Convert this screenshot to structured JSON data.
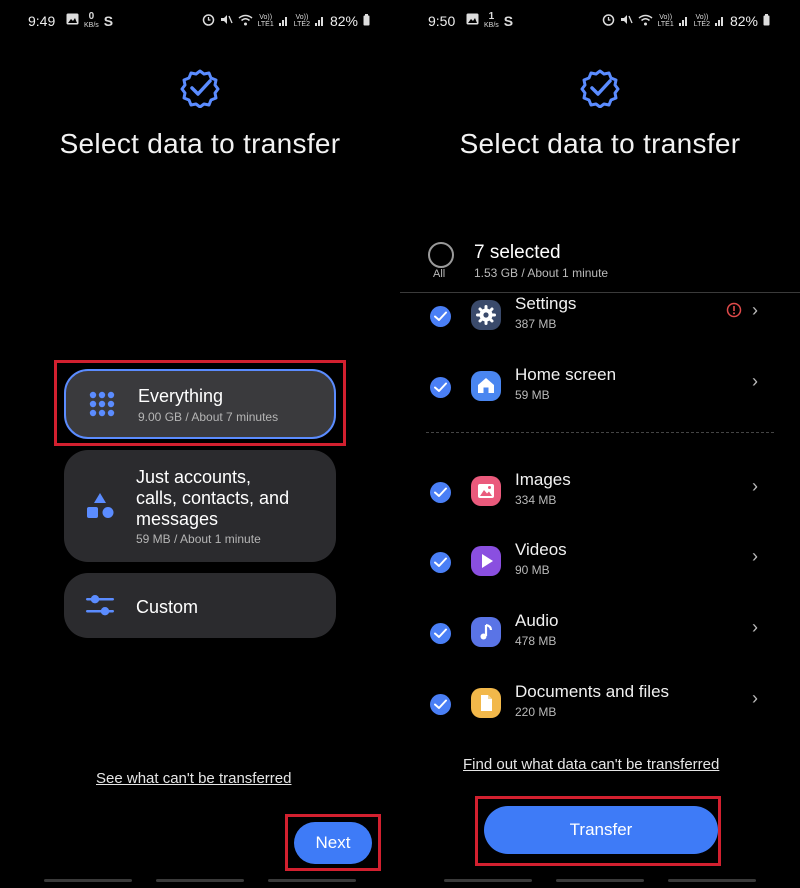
{
  "left": {
    "status": {
      "time": "9:49",
      "net_speed": "0",
      "net_unit": "KB/s",
      "carrier_s": "S",
      "lte1_top": "Vo))",
      "lte1_bot": "LTE1",
      "lte2_top": "Vo))",
      "lte2_bot": "LTE2",
      "battery": "82%"
    },
    "title": "Select data to transfer",
    "options": [
      {
        "title": "Everything",
        "subtitle": "9.00 GB / About 7 minutes"
      },
      {
        "title_lines": [
          "Just accounts,",
          "calls, contacts, and",
          "messages"
        ],
        "subtitle": "59 MB / About 1 minute"
      },
      {
        "title": "Custom"
      }
    ],
    "link": "See what can't be transferred",
    "next_label": "Next"
  },
  "right": {
    "status": {
      "time": "9:50",
      "net_speed": "1",
      "net_unit": "KB/s",
      "carrier_s": "S",
      "lte1_top": "Vo))",
      "lte1_bot": "LTE1",
      "lte2_top": "Vo))",
      "lte2_bot": "LTE2",
      "battery": "82%"
    },
    "title": "Select data to transfer",
    "all_label": "All",
    "selected_title": "7 selected",
    "selected_sub": "1.53 GB / About 1 minute",
    "items": [
      {
        "name": "Settings",
        "size": "387 MB",
        "icon": "gear-icon",
        "color": "#3a4a6b"
      },
      {
        "name": "Home screen",
        "size": "59 MB",
        "icon": "home-icon",
        "color": "#4a86f0"
      },
      {
        "name": "Images",
        "size": "334 MB",
        "icon": "image-icon",
        "color": "#ea5a7c"
      },
      {
        "name": "Videos",
        "size": "90 MB",
        "icon": "play-icon",
        "color": "#8a4fe0"
      },
      {
        "name": "Audio",
        "size": "478 MB",
        "icon": "music-icon",
        "color": "#5a74e6"
      },
      {
        "name": "Documents and files",
        "size": "220 MB",
        "icon": "document-icon",
        "color": "#f2b84a"
      }
    ],
    "link": "Find out what data can't be transferred",
    "transfer_label": "Transfer"
  },
  "colors": {
    "accent": "#3e7bf7",
    "highlight_border": "#d2202f",
    "warning": "#e04a4a"
  }
}
